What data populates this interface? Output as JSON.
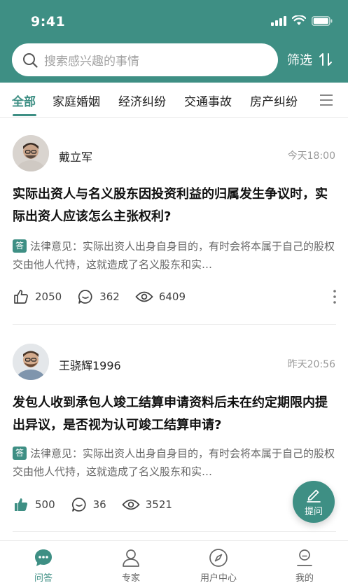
{
  "status_bar": {
    "time": "9:41"
  },
  "search": {
    "placeholder": "搜索感兴趣的事情"
  },
  "filter": {
    "label": "筛选"
  },
  "tabs": [
    {
      "label": "全部",
      "active": true
    },
    {
      "label": "家庭婚姻"
    },
    {
      "label": "经济纠纷"
    },
    {
      "label": "交通事故"
    },
    {
      "label": "房产纠纷"
    }
  ],
  "posts": [
    {
      "author": "戴立军",
      "time": "今天18:00",
      "title": "实际出资人与名义股东因投资利益的归属发生争议时，实际出资人应该怎么主张权利?",
      "badge": "答",
      "excerpt": "法律意见：实际出资人出身自身目的，有时会将本属于自己的股权交由他人代持，这就造成了名义股东和实…",
      "likes": "2050",
      "comments": "362",
      "views": "6409",
      "liked": false
    },
    {
      "author": "王骁辉1996",
      "time": "昨天20:56",
      "title": "发包人收到承包人竣工结算申请资料后未在约定期限内提出异议，是否视为认可竣工结算申请?",
      "badge": "答",
      "excerpt": "法律意见：实际出资人出身自身目的，有时会将本属于自己的股权交由他人代持，这就造成了名义股东和实…",
      "likes": "500",
      "comments": "36",
      "views": "3521",
      "liked": true
    }
  ],
  "fab": {
    "label": "提问"
  },
  "tabbar": [
    {
      "label": "问答",
      "active": true
    },
    {
      "label": "专家"
    },
    {
      "label": "用户中心"
    },
    {
      "label": "我的"
    }
  ],
  "colors": {
    "primary": "#3e8f84"
  }
}
